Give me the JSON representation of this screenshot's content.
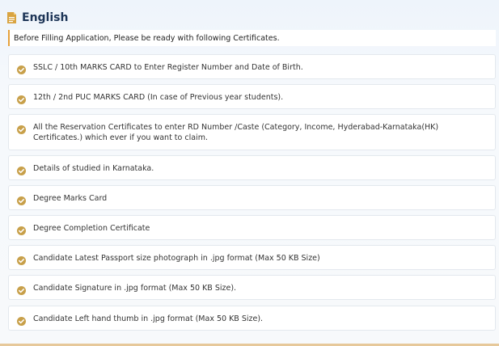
{
  "header": {
    "title": "English",
    "icon": "document-icon",
    "icon_color": "#d9a441"
  },
  "notice": {
    "text": "Before Filling Application, Please be ready with following Certificates.",
    "accent_color": "#e6a23c"
  },
  "certificates": {
    "check_color": "#c8a04a",
    "items": [
      {
        "label": "SSLC / 10th MARKS CARD to Enter Register Number and Date of Birth."
      },
      {
        "label": "12th / 2nd PUC MARKS CARD (In case of Previous year students)."
      },
      {
        "label": "All the Reservation Certificates to enter RD Number /Caste (Category, Income, Hyderabad-Karnataka(HK) Certificates.) which ever if you want to claim."
      },
      {
        "label": "Details of studied in Karnataka."
      },
      {
        "label": "Degree Marks Card"
      },
      {
        "label": "Degree Completion Certificate"
      },
      {
        "label": "Candidate Latest Passport size photograph in .jpg format (Max 50 KB Size)"
      },
      {
        "label": "Candidate Signature in .jpg format (Max 50 KB Size)."
      },
      {
        "label": "Candidate Left hand thumb in .jpg format (Max 50 KB Size)."
      }
    ]
  }
}
